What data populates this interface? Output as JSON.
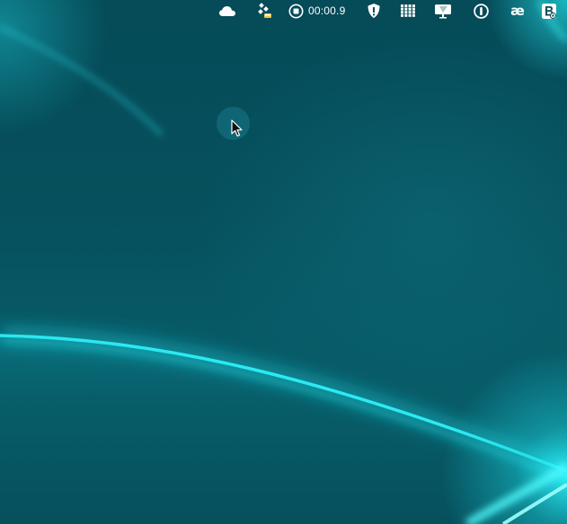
{
  "menubar": {
    "icons": [
      {
        "name": "creative-cloud-icon"
      },
      {
        "name": "dropzone-icon"
      },
      {
        "name": "screen-recording-icon"
      },
      {
        "name": "shield-alert-icon"
      },
      {
        "name": "grid-apps-icon"
      },
      {
        "name": "display-icon"
      },
      {
        "name": "onepassword-icon"
      },
      {
        "name": "keyboard-input-icon"
      },
      {
        "name": "bartender-icon"
      }
    ],
    "recording_timer": "00:00.9",
    "ae_label": "æ"
  },
  "colors": {
    "background": "#054b58",
    "accent_glow": "#1fe9f2"
  }
}
